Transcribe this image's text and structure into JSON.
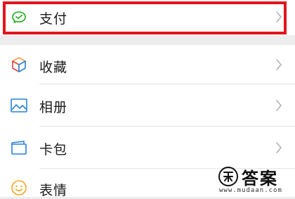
{
  "menu": {
    "items": [
      {
        "label": "支付",
        "icon": "wechat-pay-icon",
        "highlighted": true
      },
      {
        "label": "收藏",
        "icon": "favorites-cube-icon"
      },
      {
        "label": "相册",
        "icon": "album-picture-icon"
      },
      {
        "label": "卡包",
        "icon": "card-wallet-icon"
      },
      {
        "label": "表情",
        "icon": "sticker-smile-icon"
      }
    ]
  },
  "highlight_color": "#e4141b",
  "watermark": {
    "text": "答案",
    "url": "www.mudaan.com"
  }
}
